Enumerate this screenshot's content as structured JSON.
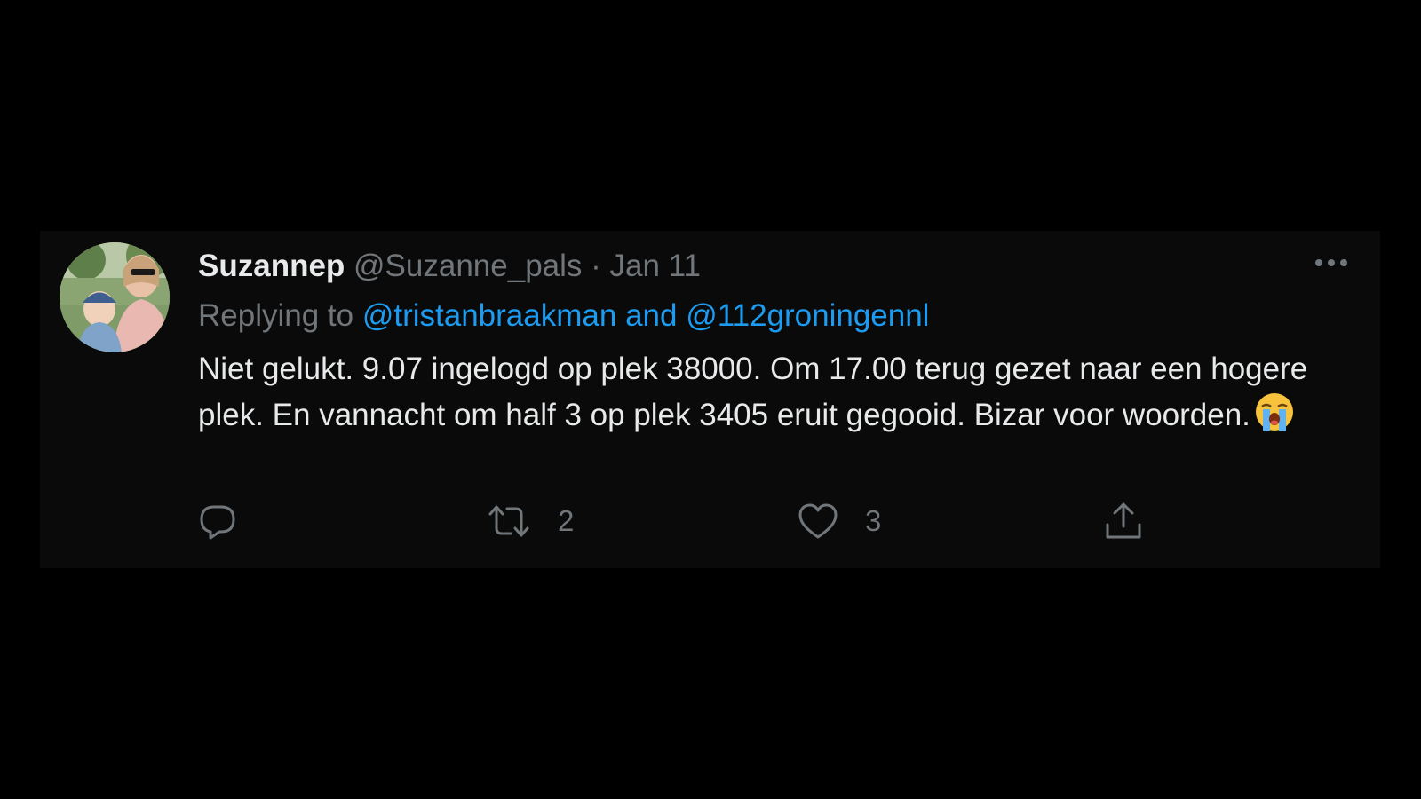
{
  "tweet": {
    "display_name": "Suzannep",
    "handle": "@Suzanne_pals",
    "separator": "·",
    "date": "Jan 11",
    "replying_prefix": "Replying to",
    "replying_mentions": [
      "@tristanbraakman",
      "@112groningennl"
    ],
    "replying_and": "and",
    "text": "Niet gelukt. 9.07 ingelogd op plek 38000. Om 17.00 terug gezet naar een hogere plek. En vannacht om half 3 op plek 3405 eruit gegooid. Bizar voor woorden.",
    "emoji": "loudly-crying-face",
    "actions": {
      "reply_count": "",
      "retweet_count": "2",
      "like_count": "3"
    }
  },
  "colors": {
    "background": "#000000",
    "card": "#0a0a0a",
    "primary_text": "#e7e9ea",
    "secondary_text": "#71767b",
    "link": "#1d9bf0"
  },
  "icons": {
    "more": "more-horizontal-icon",
    "reply": "reply-icon",
    "retweet": "retweet-icon",
    "like": "heart-icon",
    "share": "share-icon"
  }
}
